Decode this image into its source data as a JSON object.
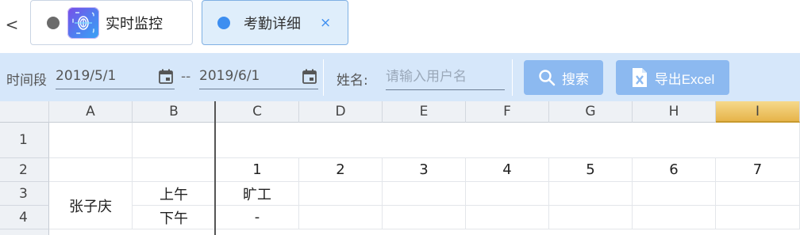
{
  "tabs": {
    "back_glyph": "<",
    "items": [
      {
        "label": "实时监控",
        "dot_color": "#6b6b6b",
        "icon": "fingerprint-app-icon"
      },
      {
        "label": "考勤详细",
        "dot_color": "#3d8ef0",
        "active": true,
        "close": "×"
      }
    ]
  },
  "filter": {
    "period_label": "时间段",
    "start_date": "2019/5/1",
    "range_sep": "--",
    "end_date": "2019/6/1",
    "name_label": "姓名:",
    "name_placeholder": "请输入用户名",
    "name_value": "",
    "search_label": "搜索",
    "export_label": "导出Excel"
  },
  "sheet": {
    "columns": [
      "A",
      "B",
      "C",
      "D",
      "E",
      "F",
      "G",
      "H",
      "I"
    ],
    "selected_column": "I",
    "rows": [
      "1",
      "2",
      "3",
      "4"
    ],
    "day_numbers": [
      "1",
      "2",
      "3",
      "4",
      "5",
      "6",
      "7"
    ],
    "employee_name": "张子庆",
    "morning_label": "上午",
    "afternoon_label": "下午",
    "c3_value": "旷工",
    "c4_value": "-"
  },
  "colors": {
    "filter_bg": "#d6e7fa",
    "button_bg": "#8cb9f0",
    "active_tab_bg": "#dfeefb",
    "selected_column_gold": "#e6b44a"
  }
}
